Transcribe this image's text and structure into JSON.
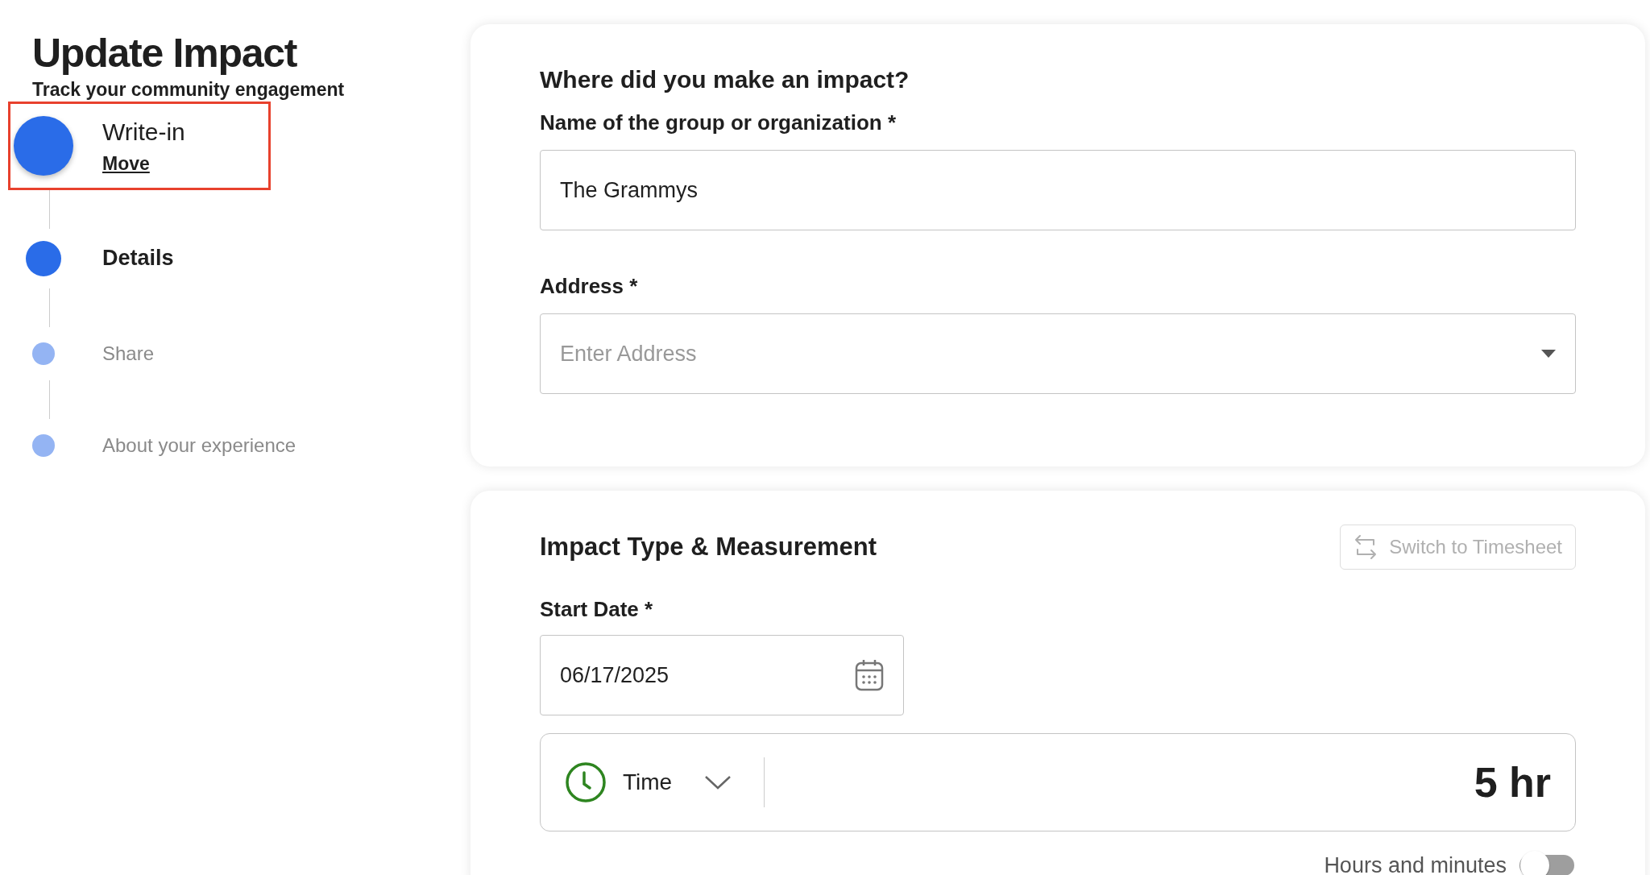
{
  "page": {
    "title": "Update Impact",
    "subtitle": "Track your community engagement"
  },
  "steps": [
    {
      "label": "Write-in",
      "kind": "done",
      "highlighted": true,
      "link": "Move"
    },
    {
      "label": "Details",
      "kind": "current",
      "highlighted": false
    },
    {
      "label": "Share",
      "kind": "upcoming",
      "highlighted": false
    },
    {
      "label": "About your experience",
      "kind": "upcoming",
      "highlighted": false
    }
  ],
  "where_card": {
    "heading": "Where did you make an impact?",
    "fields": [
      {
        "kind": "text",
        "label": "Name of the group or organization *",
        "value": "The Grammys"
      },
      {
        "kind": "select",
        "label": "Address *",
        "placeholder": "Enter Address"
      }
    ]
  },
  "impact_card": {
    "heading": "Impact Type & Measurement",
    "switch_button": {
      "label": "Switch to Timesheet",
      "disabled": true
    },
    "start_date": {
      "label": "Start Date *",
      "value": "06/17/2025"
    },
    "measure": {
      "type": "Time",
      "amount": "5 hr"
    },
    "toggle": {
      "label": "Hours and minutes",
      "on": false
    }
  }
}
